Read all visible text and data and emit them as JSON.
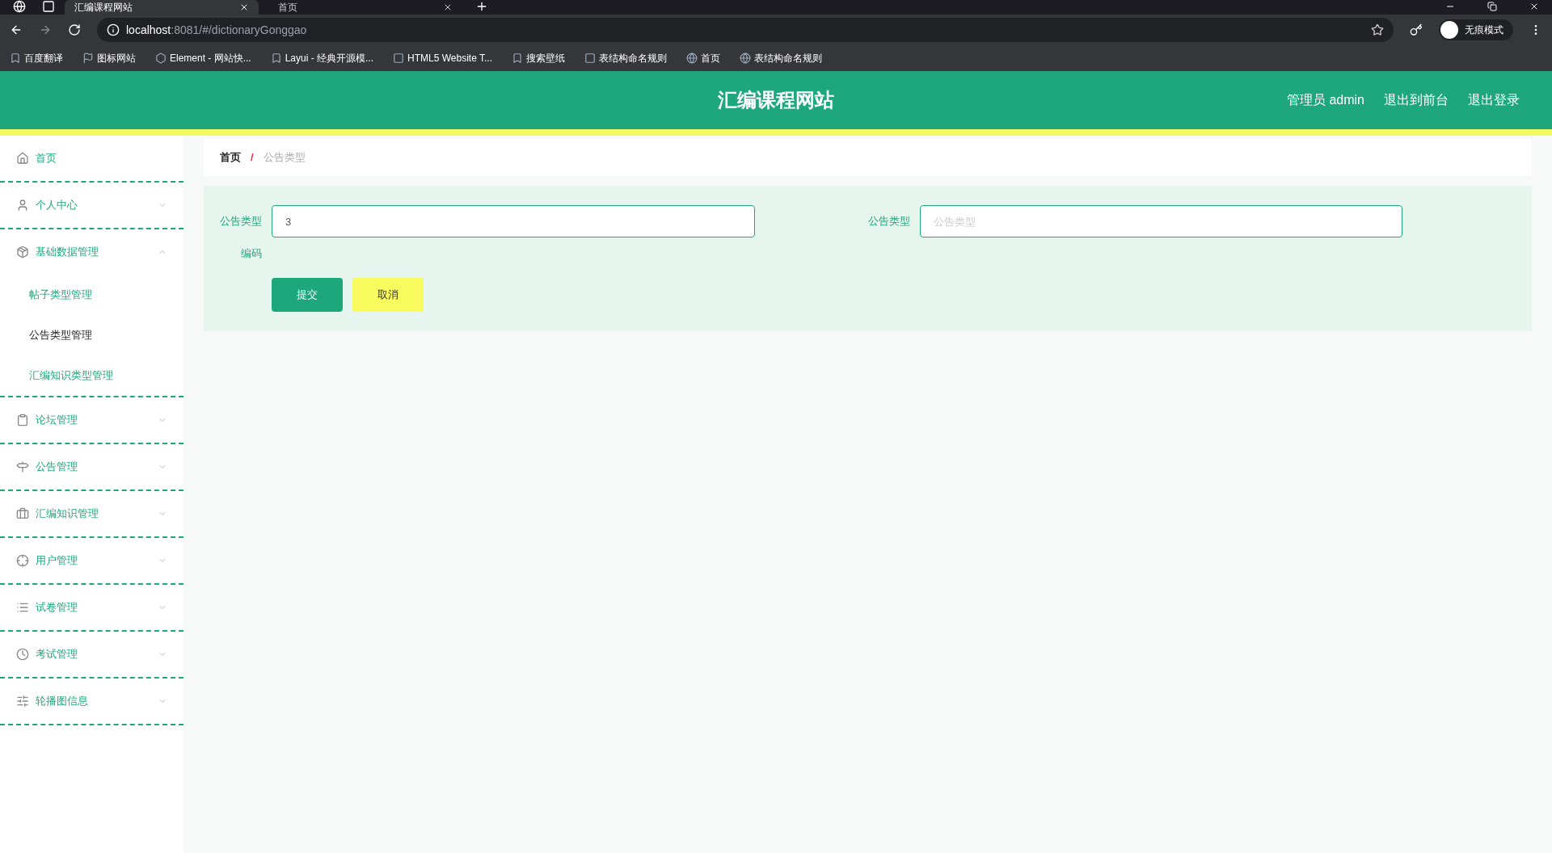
{
  "browser": {
    "tabs": [
      {
        "title": "汇编课程网站",
        "selected": true
      },
      {
        "title": "首页",
        "selected": false
      }
    ],
    "address": {
      "host": "localhost",
      "rest": ":8081/#/dictionaryGonggao"
    },
    "profile": "无痕模式",
    "bookmarks": [
      {
        "label": "百度翻译"
      },
      {
        "label": "图标网站"
      },
      {
        "label": "Element - 网站快..."
      },
      {
        "label": "Layui - 经典开源模..."
      },
      {
        "label": "HTML5 Website T..."
      },
      {
        "label": "搜索壁纸"
      },
      {
        "label": "表结构命名规则"
      },
      {
        "label": "首页"
      },
      {
        "label": "表结构命名规则"
      }
    ]
  },
  "header": {
    "title": "汇编课程网站",
    "links": [
      "管理员 admin",
      "退出到前台",
      "退出登录"
    ]
  },
  "sidebar": {
    "items": [
      {
        "label": "首页",
        "kind": "link"
      },
      {
        "label": "个人中心",
        "kind": "group",
        "expanded": false
      },
      {
        "label": "基础数据管理",
        "kind": "group",
        "expanded": true,
        "children": [
          {
            "label": "帖子类型管理",
            "selected": false
          },
          {
            "label": "公告类型管理",
            "selected": true
          },
          {
            "label": "汇编知识类型管理",
            "selected": false
          }
        ]
      },
      {
        "label": "论坛管理",
        "kind": "group",
        "expanded": false
      },
      {
        "label": "公告管理",
        "kind": "group",
        "expanded": false
      },
      {
        "label": "汇编知识管理",
        "kind": "group",
        "expanded": false
      },
      {
        "label": "用户管理",
        "kind": "group",
        "expanded": false
      },
      {
        "label": "试卷管理",
        "kind": "group",
        "expanded": false
      },
      {
        "label": "考试管理",
        "kind": "group",
        "expanded": false
      },
      {
        "label": "轮播图信息",
        "kind": "group",
        "expanded": false
      }
    ]
  },
  "breadcrumb": {
    "separator": "/",
    "items": [
      "首页",
      "公告类型"
    ]
  },
  "form": {
    "fields": [
      {
        "label": "公告类型编码",
        "value": "3"
      },
      {
        "label": "公告类型",
        "placeholder": "公告类型"
      }
    ],
    "buttons": [
      {
        "label": "提交",
        "kind": "primary"
      },
      {
        "label": "取消",
        "kind": "secondary"
      }
    ]
  }
}
